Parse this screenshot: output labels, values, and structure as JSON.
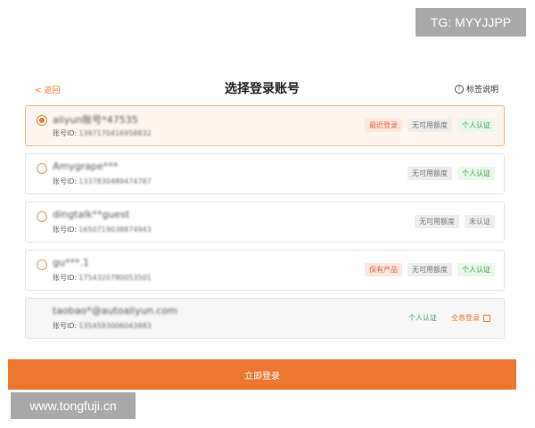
{
  "watermarks": {
    "top": "TG: MYYJJPP",
    "bottom": "www.tongfuji.cn"
  },
  "header": {
    "back_label": "< 返回",
    "title": "选择登录账号",
    "help_label": "标签说明",
    "help_icon": "?"
  },
  "accounts": [
    {
      "name": "aliyun账号*47535",
      "account_label": "账号ID:",
      "account_id": "1397170416958832",
      "selected": true,
      "tags": [
        {
          "text": "最近登录",
          "style": "orange"
        },
        {
          "text": "无可用额度",
          "style": "gray"
        },
        {
          "text": "个人认证",
          "style": "green"
        }
      ]
    },
    {
      "name": "Amygrape***",
      "account_label": "账号ID:",
      "account_id": "1337830489474787",
      "selected": false,
      "tags": [
        {
          "text": "无可用额度",
          "style": "gray"
        },
        {
          "text": "个人认证",
          "style": "green"
        }
      ]
    },
    {
      "name": "dingtalk**guest",
      "account_label": "账号ID:",
      "account_id": "1650719038874943",
      "selected": false,
      "tags": [
        {
          "text": "无可用额度",
          "style": "gray"
        },
        {
          "text": "未认证",
          "style": "gray"
        }
      ]
    },
    {
      "name": "gu***.1",
      "account_label": "账号ID:",
      "account_id": "1754320780053501",
      "selected": false,
      "tags": [
        {
          "text": "保有产品",
          "style": "orange"
        },
        {
          "text": "无可用额度",
          "style": "gray"
        },
        {
          "text": "个人认证",
          "style": "green"
        }
      ]
    },
    {
      "name": "taobao*@autoaliyun.com",
      "account_label": "账号ID:",
      "account_id": "1354593006043883",
      "selected": false,
      "disabled": true,
      "tags": [
        {
          "text": "个人认证",
          "style": "plain-green"
        },
        {
          "text": "全息登录",
          "style": "link"
        }
      ]
    }
  ],
  "footer": {
    "login_label": "立即登录"
  },
  "colors": {
    "accent": "#ed7731",
    "selected_bg": "#fef6ee",
    "green": "#39a04a"
  }
}
